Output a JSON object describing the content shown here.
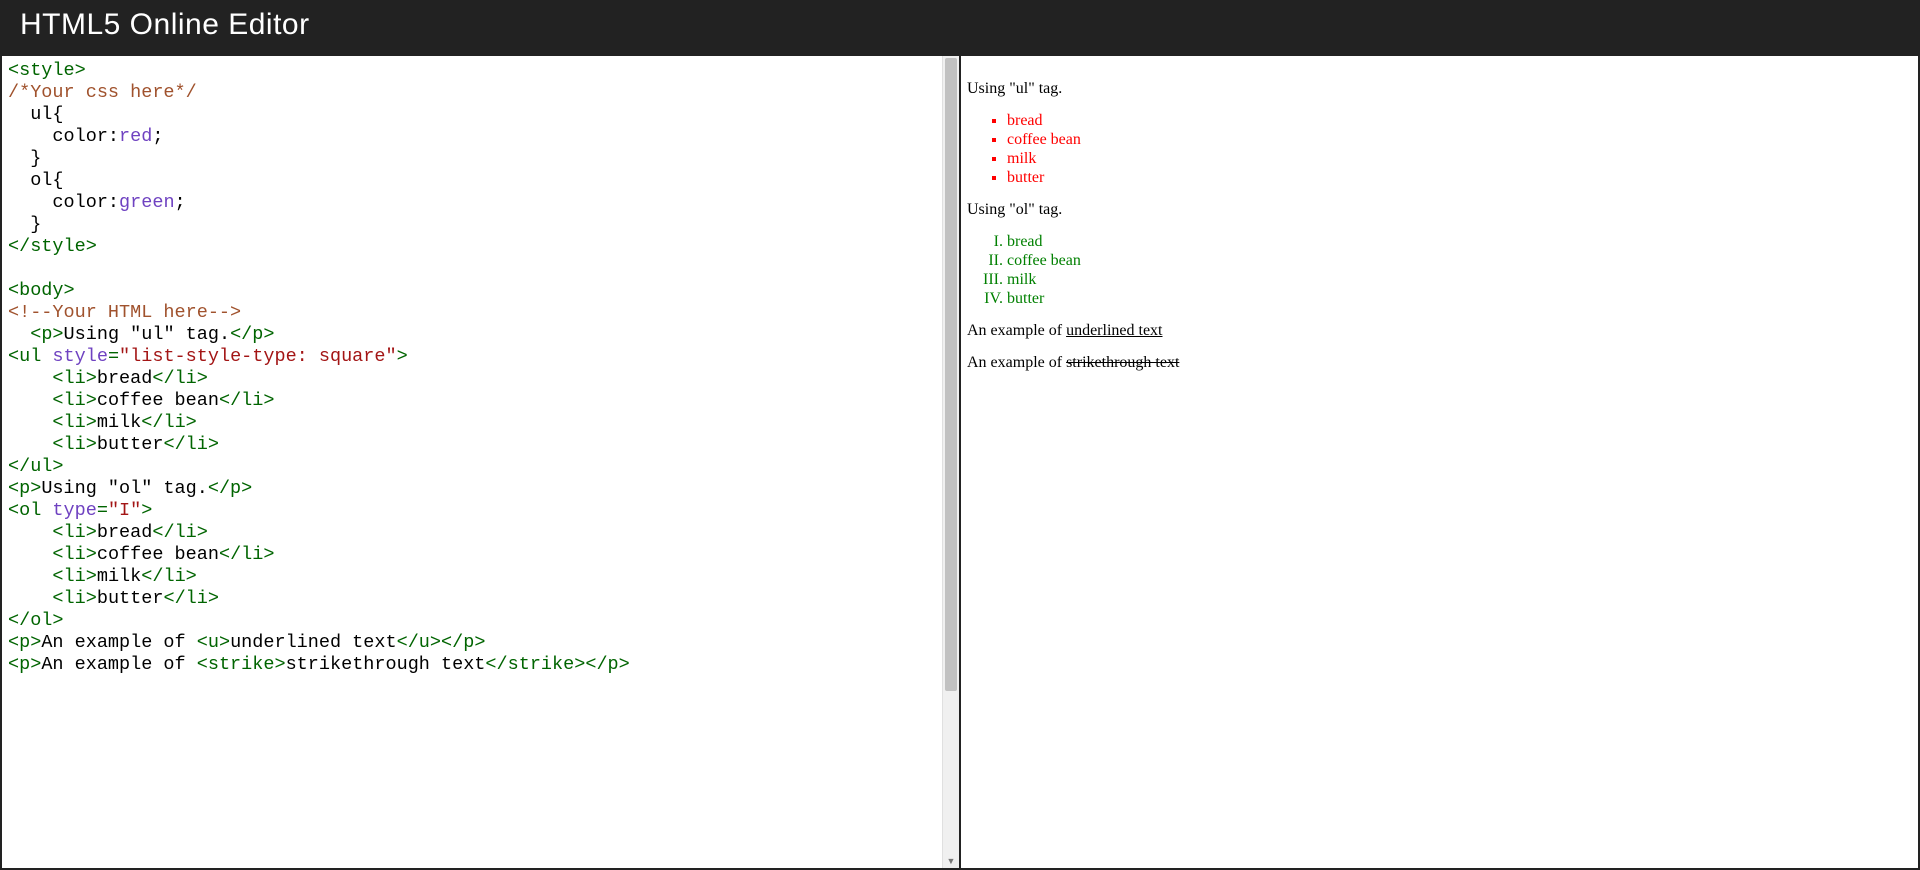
{
  "header": {
    "title": "HTML5 Online Editor"
  },
  "code_lines": [
    [
      {
        "c": "tag",
        "t": "<style>"
      }
    ],
    [
      {
        "c": "cmt",
        "t": "/*Your css here*/"
      }
    ],
    [
      {
        "c": "",
        "t": "  ul{"
      }
    ],
    [
      {
        "c": "",
        "t": "    color:"
      },
      {
        "c": "attr",
        "t": "red"
      },
      {
        "c": "",
        "t": ";"
      }
    ],
    [
      {
        "c": "",
        "t": "  }"
      }
    ],
    [
      {
        "c": "",
        "t": "  ol{"
      }
    ],
    [
      {
        "c": "",
        "t": "    color:"
      },
      {
        "c": "attr",
        "t": "green"
      },
      {
        "c": "",
        "t": ";"
      }
    ],
    [
      {
        "c": "",
        "t": "  }"
      }
    ],
    [
      {
        "c": "tag",
        "t": "</style>"
      }
    ],
    [
      {
        "c": "",
        "t": ""
      }
    ],
    [
      {
        "c": "tag",
        "t": "<body>"
      }
    ],
    [
      {
        "c": "cmt",
        "t": "<!--Your HTML here-->"
      }
    ],
    [
      {
        "c": "",
        "t": "  "
      },
      {
        "c": "tag",
        "t": "<p>"
      },
      {
        "c": "",
        "t": "Using \"ul\" tag."
      },
      {
        "c": "tag",
        "t": "</p>"
      }
    ],
    [
      {
        "c": "tag",
        "t": "<ul "
      },
      {
        "c": "attr",
        "t": "style"
      },
      {
        "c": "tag",
        "t": "="
      },
      {
        "c": "val",
        "t": "\"list-style-type: square\""
      },
      {
        "c": "tag",
        "t": ">"
      }
    ],
    [
      {
        "c": "",
        "t": "    "
      },
      {
        "c": "tag",
        "t": "<li>"
      },
      {
        "c": "",
        "t": "bread"
      },
      {
        "c": "tag",
        "t": "</li>"
      }
    ],
    [
      {
        "c": "",
        "t": "    "
      },
      {
        "c": "tag",
        "t": "<li>"
      },
      {
        "c": "",
        "t": "coffee bean"
      },
      {
        "c": "tag",
        "t": "</li>"
      }
    ],
    [
      {
        "c": "",
        "t": "    "
      },
      {
        "c": "tag",
        "t": "<li>"
      },
      {
        "c": "",
        "t": "milk"
      },
      {
        "c": "tag",
        "t": "</li>"
      }
    ],
    [
      {
        "c": "",
        "t": "    "
      },
      {
        "c": "tag",
        "t": "<li>"
      },
      {
        "c": "",
        "t": "butter"
      },
      {
        "c": "tag",
        "t": "</li>"
      }
    ],
    [
      {
        "c": "tag",
        "t": "</ul>"
      }
    ],
    [
      {
        "c": "tag",
        "t": "<p>"
      },
      {
        "c": "",
        "t": "Using \"ol\" tag."
      },
      {
        "c": "tag",
        "t": "</p>"
      }
    ],
    [
      {
        "c": "tag",
        "t": "<ol "
      },
      {
        "c": "attr",
        "t": "type"
      },
      {
        "c": "tag",
        "t": "="
      },
      {
        "c": "val",
        "t": "\"I\""
      },
      {
        "c": "tag",
        "t": ">"
      }
    ],
    [
      {
        "c": "",
        "t": "    "
      },
      {
        "c": "tag",
        "t": "<li>"
      },
      {
        "c": "",
        "t": "bread"
      },
      {
        "c": "tag",
        "t": "</li>"
      }
    ],
    [
      {
        "c": "",
        "t": "    "
      },
      {
        "c": "tag",
        "t": "<li>"
      },
      {
        "c": "",
        "t": "coffee bean"
      },
      {
        "c": "tag",
        "t": "</li>"
      }
    ],
    [
      {
        "c": "",
        "t": "    "
      },
      {
        "c": "tag",
        "t": "<li>"
      },
      {
        "c": "",
        "t": "milk"
      },
      {
        "c": "tag",
        "t": "</li>"
      }
    ],
    [
      {
        "c": "",
        "t": "    "
      },
      {
        "c": "tag",
        "t": "<li>"
      },
      {
        "c": "",
        "t": "butter"
      },
      {
        "c": "tag",
        "t": "</li>"
      }
    ],
    [
      {
        "c": "tag",
        "t": "</ol>"
      }
    ],
    [
      {
        "c": "tag",
        "t": "<p>"
      },
      {
        "c": "",
        "t": "An example of "
      },
      {
        "c": "tag",
        "t": "<u>"
      },
      {
        "c": "",
        "t": "underlined text"
      },
      {
        "c": "tag",
        "t": "</u>"
      },
      {
        "c": "tag",
        "t": "</p>"
      }
    ],
    [
      {
        "c": "tag",
        "t": "<p>"
      },
      {
        "c": "",
        "t": "An example of "
      },
      {
        "c": "tag",
        "t": "<strike>"
      },
      {
        "c": "",
        "t": "strikethrough text"
      },
      {
        "c": "tag",
        "t": "</strike>"
      },
      {
        "c": "tag",
        "t": "</p>"
      }
    ]
  ],
  "preview": {
    "p_ul_heading": "Using \"ul\" tag.",
    "ul_items": [
      "bread",
      "coffee bean",
      "milk",
      "butter"
    ],
    "p_ol_heading": "Using \"ol\" tag.",
    "ol_items": [
      "bread",
      "coffee bean",
      "milk",
      "butter"
    ],
    "underline_prefix": "An example of ",
    "underline_text": "underlined text",
    "strike_prefix": "An example of ",
    "strike_text": "strikethrough text"
  }
}
